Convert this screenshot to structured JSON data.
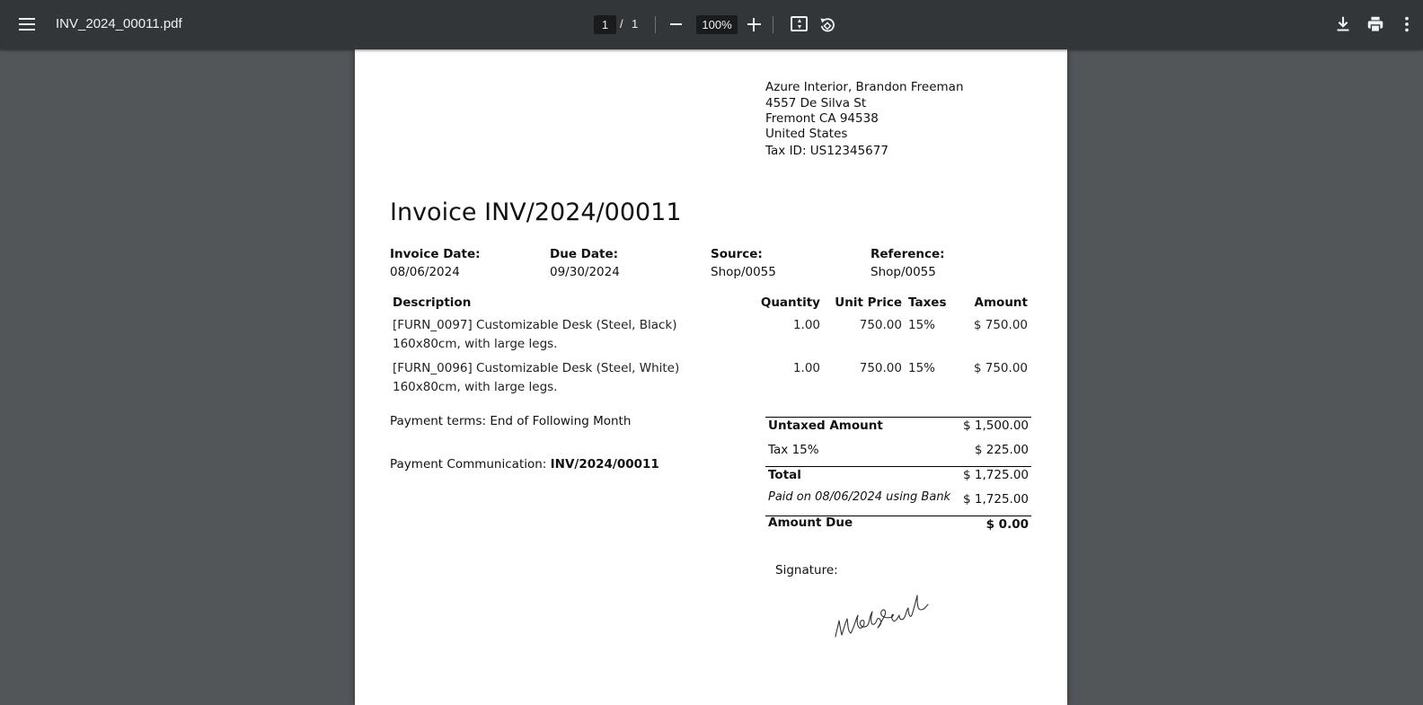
{
  "viewer": {
    "file_name": "INV_2024_00011.pdf",
    "current_page": "1",
    "page_separator": "/",
    "total_pages": "1",
    "zoom": "100%"
  },
  "seller": {
    "name": "Azure Interior, Brandon Freeman",
    "street": "4557 De Silva St",
    "city": "Fremont CA 94538",
    "country": "United States",
    "tax_id": "Tax ID: US12345677"
  },
  "invoice": {
    "title": "Invoice INV/2024/00011",
    "info": [
      {
        "label": "Invoice Date:",
        "value": "08/06/2024"
      },
      {
        "label": "Due Date:",
        "value": "09/30/2024"
      },
      {
        "label": "Source:",
        "value": "Shop/0055"
      },
      {
        "label": "Reference:",
        "value": "Shop/0055"
      }
    ],
    "columns": {
      "description": "Description",
      "quantity": "Quantity",
      "unit_price": "Unit Price",
      "taxes": "Taxes",
      "amount": "Amount"
    },
    "lines": [
      {
        "description_1": "[FURN_0097] Customizable Desk (Steel, Black)",
        "description_2": "160x80cm, with large legs.",
        "quantity": "1.00",
        "unit_price": "750.00",
        "taxes": "15%",
        "amount": "$ 750.00"
      },
      {
        "description_1": "[FURN_0096] Customizable Desk (Steel, White)",
        "description_2": "160x80cm, with large legs.",
        "quantity": "1.00",
        "unit_price": "750.00",
        "taxes": "15%",
        "amount": "$ 750.00"
      }
    ],
    "payment_terms": "Payment terms: End of Following Month",
    "payment_communication_label": "Payment Communication: ",
    "payment_communication_value": "INV/2024/00011",
    "totals": {
      "untaxed_label": "Untaxed Amount",
      "untaxed_value": "$ 1,500.00",
      "tax_label": "Tax 15%",
      "tax_value": "$ 225.00",
      "total_label": "Total",
      "total_value": "$ 1,725.00",
      "paid_label": "Paid on 08/06/2024 using Bank",
      "paid_value": "$ 1,725.00",
      "due_label": "Amount Due",
      "due_value": "$ 0.00"
    },
    "signature_label": "Signature:"
  },
  "icons": {
    "menu": "menu-icon",
    "zoom_out": "minus-icon",
    "zoom_in": "plus-icon",
    "fit": "fit-to-page-icon",
    "rotate": "rotate-icon",
    "download": "download-icon",
    "print": "print-icon",
    "more": "more-vert-icon"
  }
}
